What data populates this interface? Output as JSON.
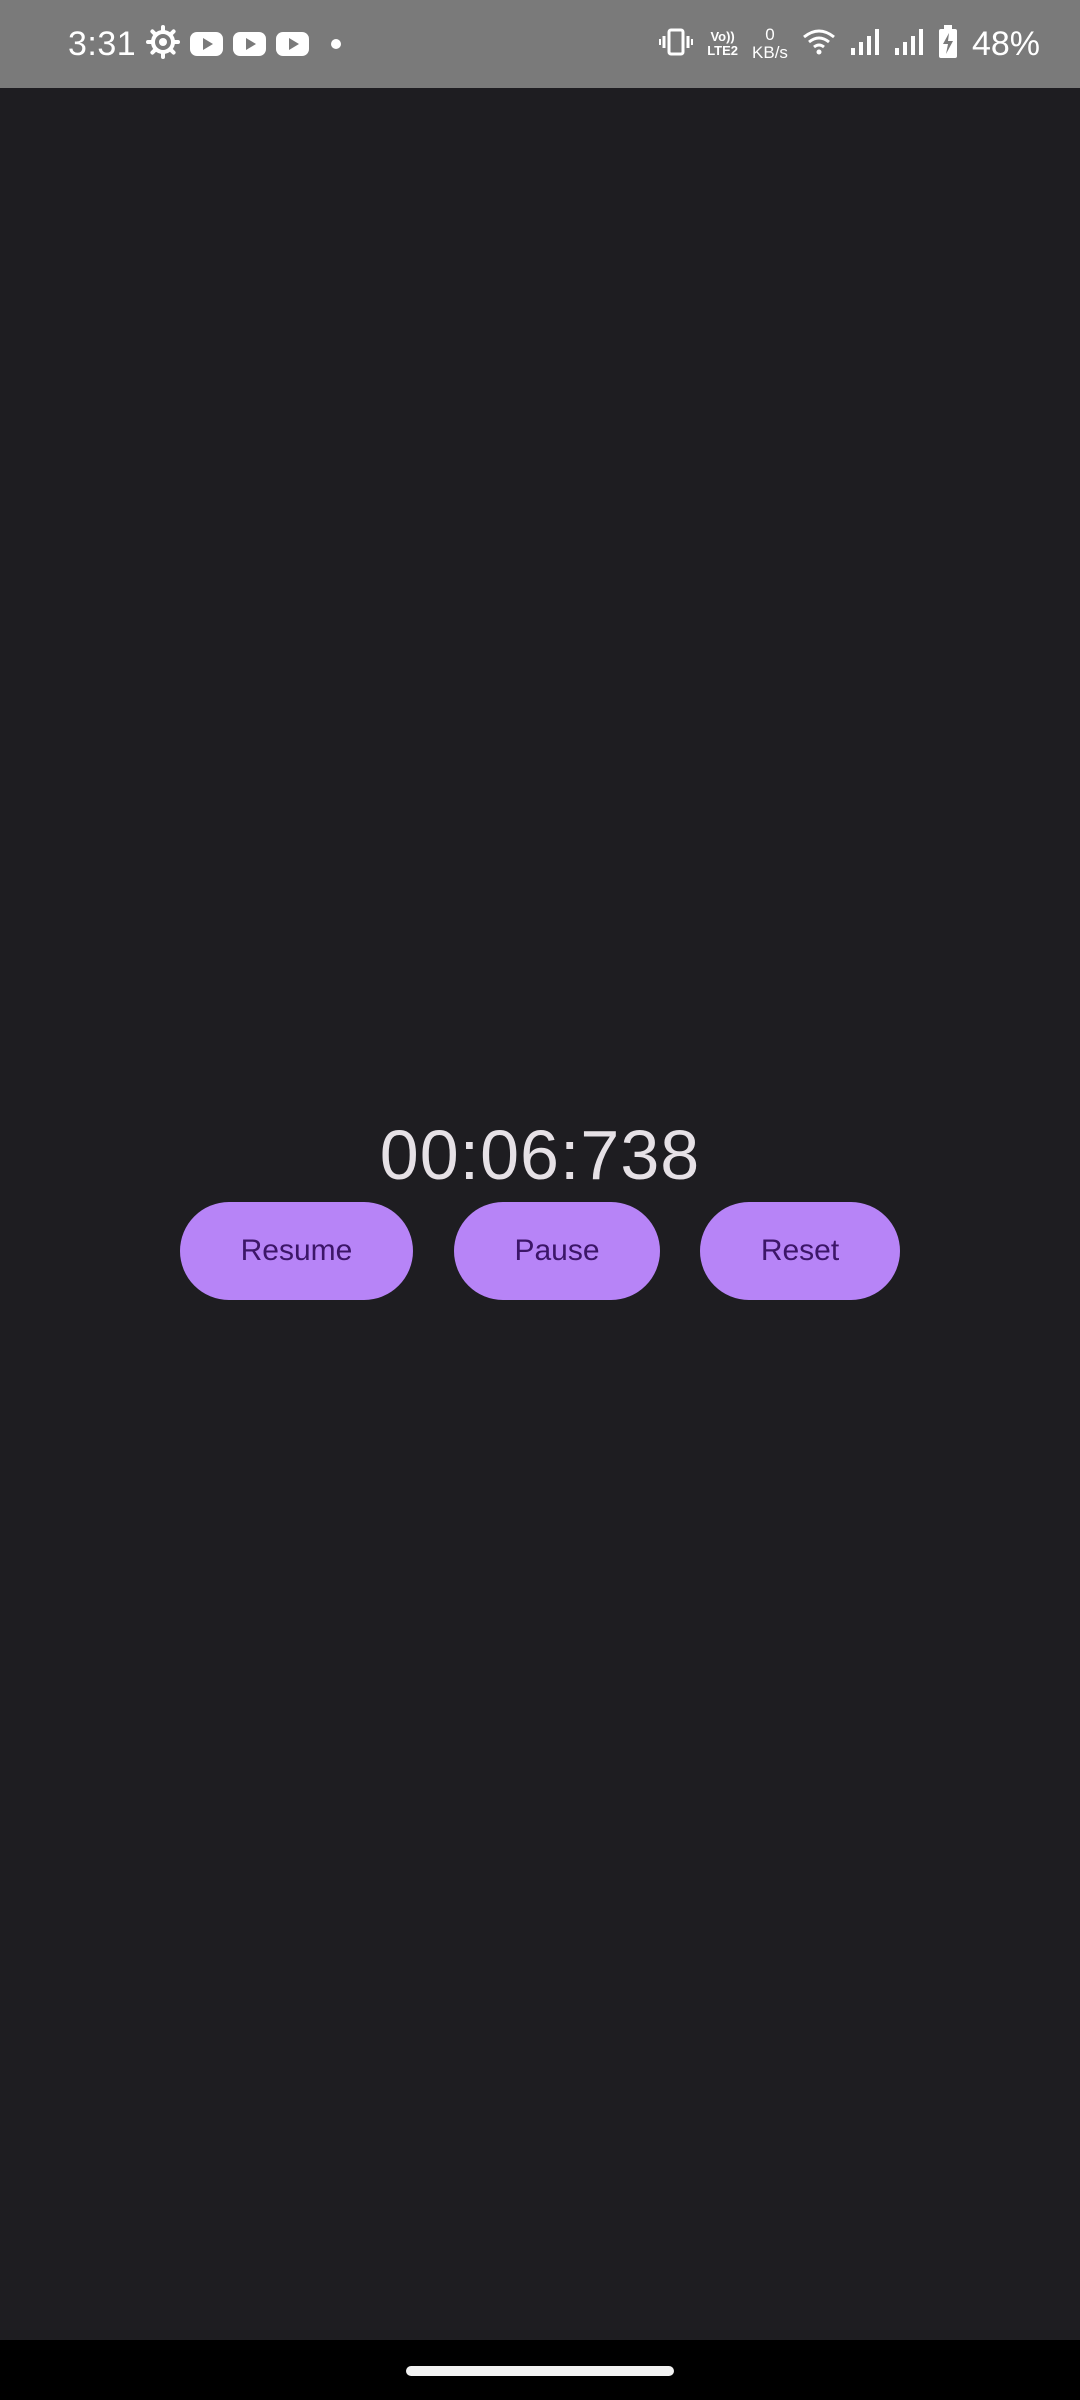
{
  "status_bar": {
    "time": "3:31",
    "left_icons": [
      "settings-icon",
      "youtube-icon",
      "youtube-icon",
      "youtube-icon",
      "notification-dot"
    ],
    "volte_top": "Vo))",
    "volte_bottom": "LTE2",
    "speed_value": "0",
    "speed_unit": "KB/s",
    "right_icons": [
      "vibrate-icon",
      "wifi-icon",
      "signal-icon",
      "signal-icon",
      "battery-charging-icon"
    ],
    "battery_percent": "48%"
  },
  "stopwatch": {
    "time": "00:06:738"
  },
  "buttons": {
    "resume": "Resume",
    "pause": "Pause",
    "reset": "Reset"
  },
  "colors": {
    "background": "#1e1d21",
    "status_bar": "#7a7a7a",
    "button_fill": "#b784f7",
    "button_text": "#3c1668",
    "timer_text": "#e6e1e6"
  }
}
